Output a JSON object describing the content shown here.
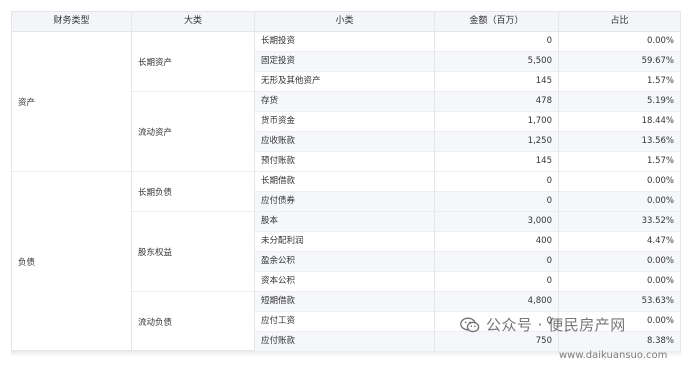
{
  "table": {
    "headers": [
      "财务类型",
      "大类",
      "小类",
      "金额（百万）",
      "占比"
    ],
    "types": [
      "资产",
      "负债"
    ],
    "majors": [
      "长期资产",
      "流动资产",
      "长期负债",
      "股东权益",
      "流动负债"
    ],
    "rows": [
      {
        "minor": "长期投资",
        "amount": "0",
        "ratio": "0.00%"
      },
      {
        "minor": "固定投资",
        "amount": "5,500",
        "ratio": "59.67%"
      },
      {
        "minor": "无形及其他资产",
        "amount": "145",
        "ratio": "1.57%"
      },
      {
        "minor": "存货",
        "amount": "478",
        "ratio": "5.19%"
      },
      {
        "minor": "货币资金",
        "amount": "1,700",
        "ratio": "18.44%"
      },
      {
        "minor": "应收账款",
        "amount": "1,250",
        "ratio": "13.56%"
      },
      {
        "minor": "预付账款",
        "amount": "145",
        "ratio": "1.57%"
      },
      {
        "minor": "长期借款",
        "amount": "0",
        "ratio": "0.00%"
      },
      {
        "minor": "应付债券",
        "amount": "0",
        "ratio": "0.00%"
      },
      {
        "minor": "股本",
        "amount": "3,000",
        "ratio": "33.52%"
      },
      {
        "minor": "未分配利润",
        "amount": "400",
        "ratio": "4.47%"
      },
      {
        "minor": "盈余公积",
        "amount": "0",
        "ratio": "0.00%"
      },
      {
        "minor": "资本公积",
        "amount": "0",
        "ratio": "0.00%"
      },
      {
        "minor": "短期借款",
        "amount": "4,800",
        "ratio": "53.63%"
      },
      {
        "minor": "应付工资",
        "amount": "0",
        "ratio": "0.00%"
      },
      {
        "minor": "应付账款",
        "amount": "750",
        "ratio": "8.38%"
      }
    ]
  },
  "watermark": {
    "text": "公众号 · 便民房产网",
    "url": "www.daikuansuo.com",
    "icon": "wechat-icon"
  }
}
